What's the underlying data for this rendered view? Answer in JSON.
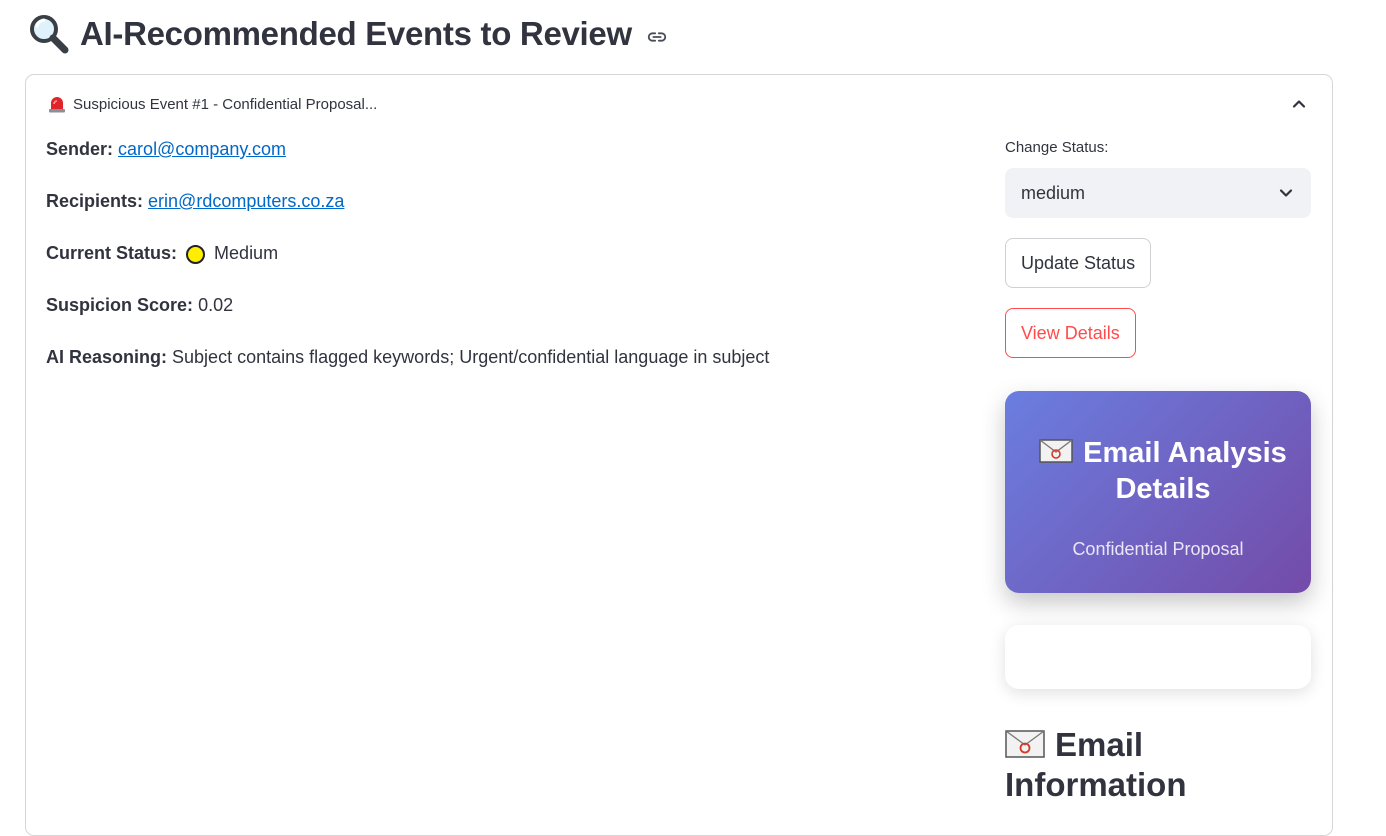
{
  "header": {
    "title": "AI-Recommended Events to Review",
    "title_icon": "magnifier-icon",
    "anchor_icon": "link-icon"
  },
  "event": {
    "header_label": "Suspicious Event #1 - Confidential Proposal...",
    "header_icon": "siren-icon",
    "sender_label": "Sender:",
    "sender_value": "carol@company.com",
    "recipients_label": "Recipients:",
    "recipients_value": "erin@rdcomputers.co.za",
    "status_label": "Current Status:",
    "status_value": "Medium",
    "status_color": "#ffee00",
    "score_label": "Suspicion Score:",
    "score_value": "0.02",
    "reasoning_label": "AI Reasoning:",
    "reasoning_value": "Subject contains flagged keywords; Urgent/confidential language in subject"
  },
  "actions": {
    "change_status_label": "Change Status:",
    "selected_status": "medium",
    "update_button": "Update Status",
    "view_button": "View Details"
  },
  "analysis_card": {
    "title": "Email Analysis Details",
    "subtitle": "Confidential Proposal",
    "gradient_start": "#6a7ee0",
    "gradient_end": "#744ba8"
  },
  "info_section": {
    "heading": "Email Information"
  },
  "colors": {
    "link": "#0068c9",
    "accent_red": "#ff4b4b",
    "text": "#31333f"
  }
}
